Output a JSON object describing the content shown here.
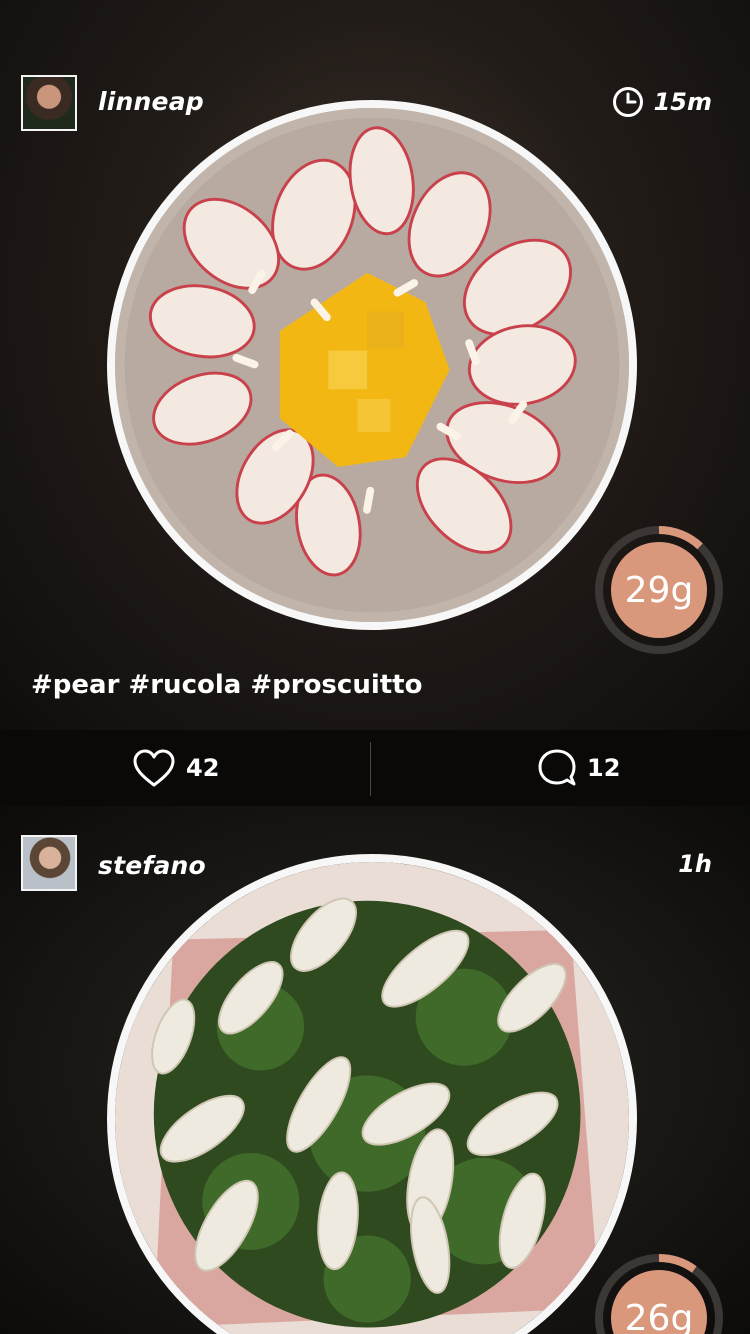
{
  "posts": [
    {
      "username": "linneap",
      "time": "15m",
      "carbs": "29g",
      "carb_progress": 0.12,
      "hashtags": "#pear #rucola #proscuitto",
      "likes": "42",
      "comments": "12",
      "icons": {
        "time": "clock-icon",
        "like": "heart-icon",
        "comment": "comment-icon"
      }
    },
    {
      "username": "stefano",
      "time": "1h",
      "carbs": "26g",
      "carb_progress": 0.1
    }
  ],
  "colors": {
    "accent": "#d9977c",
    "ring_track": "#3a3735",
    "divider": "#4a4644"
  }
}
